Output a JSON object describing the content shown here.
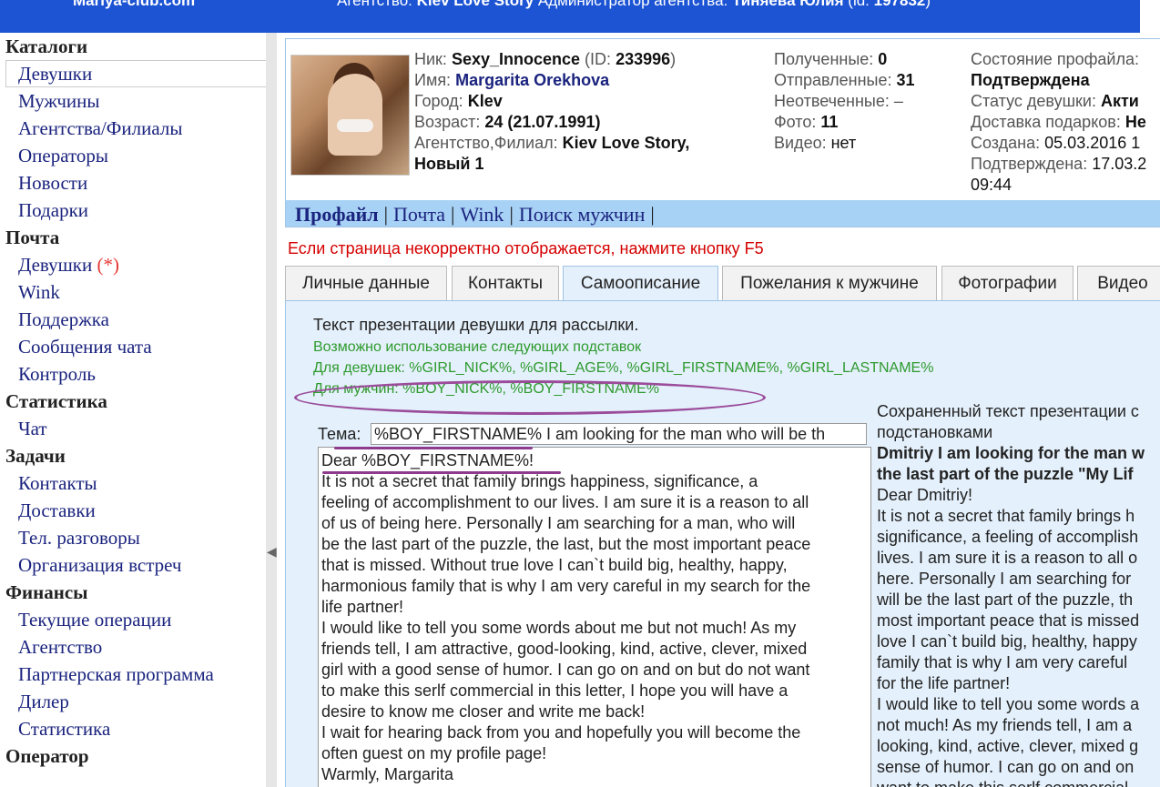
{
  "header": {
    "site": "Mariya-club.com",
    "agency_prefix": "Агентство:",
    "agency_name": "Kiev Love Story",
    "admin_prefix": "Администратор агентства:",
    "admin_name": "Тиняева Юлия",
    "admin_id_prefix": "(id:",
    "admin_id": "197832",
    "admin_id_suffix": ")"
  },
  "sidebar": {
    "sections": [
      {
        "title": "Каталоги",
        "items": [
          "Девушки",
          "Мужчины",
          "Агентства/Филиалы",
          "Операторы",
          "Новости",
          "Подарки"
        ]
      },
      {
        "title": "Почта",
        "items": [
          "Девушки",
          "Wink",
          "Поддержка",
          "Сообщения чата",
          "Контроль"
        ]
      },
      {
        "title": "Статистика",
        "items": [
          "Чат"
        ]
      },
      {
        "title": "Задачи",
        "items": [
          "Контакты",
          "Доставки",
          "Тел. разговоры",
          "Организация встреч"
        ]
      },
      {
        "title": "Финансы",
        "items": [
          "Текущие операции",
          "Агентство",
          "Партнерская программа",
          "Дилер",
          "Статистика"
        ]
      },
      {
        "title": "Оператор",
        "items": []
      }
    ],
    "mail_girls_star": "(*)"
  },
  "profile": {
    "nick_label": "Ник:",
    "nick": "Sexy_Innocence",
    "id_label": "(ID:",
    "id": "233996",
    "id_close": ")",
    "name_label": "Имя:",
    "name": "Margarita Orekhova",
    "city_label": "Город:",
    "city": "Klev",
    "age_label": "Возраст:",
    "age": "24 (21.07.1991)",
    "agency_label": "Агентство,Филиал:",
    "agency": "Kiev Love Story,",
    "branch": "Новый 1",
    "received_label": "Полученные:",
    "received": "0",
    "sent_label": "Отправленные:",
    "sent": "31",
    "unanswered_label": "Неотвеченные:",
    "unanswered": "–",
    "photo_label": "Фото:",
    "photo": "11",
    "video_label": "Видео:",
    "video": "нет",
    "state_label": "Состояние профайла:",
    "state": "Подтверждена",
    "status_label": "Статус девушки:",
    "status": "Акти",
    "gifts_label": "Доставка подарков:",
    "gifts": "Не",
    "created_label": "Создана:",
    "created": "05.03.2016 1",
    "confirmed_label": "Подтверждена:",
    "confirmed": "17.03.2",
    "confirmed_time": "09:44"
  },
  "profile_nav": [
    "Профайл",
    "Почта",
    "Wink",
    "Поиск мужчин"
  ],
  "warning": "Если страница некорректно отображается, нажмите кнопку F5",
  "tabs": [
    "Личные данные",
    "Контакты",
    "Самоописание",
    "Пожелания к мужчине",
    "Фотографии",
    "Видео"
  ],
  "content": {
    "intro": "Текст презентации девушки для рассылки.",
    "hint1": "Возможно использование следующих подставок",
    "hint2": "Для девушек: %GIRL_NICK%, %GIRL_AGE%, %GIRL_FIRSTNAME%, %GIRL_LASTNAME%",
    "hint3": "Для мужчин: %BOY_NICK%, %BOY_FIRSTNAME%",
    "subject_label": "Тема:",
    "subject_value": "%BOY_FIRSTNAME% I am looking for the man who will be th",
    "letter_lines": [
      "Dear %BOY_FIRSTNAME%!",
      "It is not a secret that family brings  happiness, significance, a",
      "feeling of accomplishment to our lives. I am sure it is a reason to all",
      "of us of being here. Personally I am searching for a man, who will",
      "be the last part of the puzzle, the last, but the most important peace",
      "that is missed. Without true love I can`t build big, healthy, happy,",
      "harmonious family that is why I am very careful in my search for the",
      "life partner!",
      "I would like to tell you some words about me but not much!  As my",
      "friends tell, I am attractive, good-looking, kind, active, clever, mixed",
      "girl with a good sense of humor. I can go on and on but do not want",
      "to make this  serlf commercial in this letter, I hope you will have a",
      "desire to know me closer and write me back!",
      " I wait for hearing back from you and hopefully you will become the",
      "often guest on my  profile page!",
      "Warmly, Margarita"
    ],
    "saved_head": [
      "Сохраненный текст презентации с",
      "подстановками"
    ],
    "saved_subject": [
      "Dmitriy I am looking for the man w",
      "the last part of the puzzle \"My Lif"
    ],
    "saved_lines": [
      "Dear Dmitriy!",
      "It is not a secret that family brings h",
      "significance, a feeling of accomplish",
      "lives. I am sure it is a reason to all o",
      "here. Personally I am searching for",
      "will be the last part of the puzzle, th",
      "most important peace that is missed",
      "love I can`t build big, healthy, happy",
      "family that is why I am very careful",
      "for the life partner!",
      "I would like to tell you some words a",
      "not much! As my friends tell, I am a",
      "looking, kind, active, clever, mixed g",
      "sense of humor. I can go on and on",
      "want to make this serlf commercial"
    ]
  },
  "colors": {
    "header_bg": "#1c54d4",
    "nav_bg": "#a8d2f5",
    "content_bg": "#e4f0fb",
    "hint": "#2e9a2e",
    "warning": "#d50000",
    "annotation": "#9b4c9b"
  }
}
